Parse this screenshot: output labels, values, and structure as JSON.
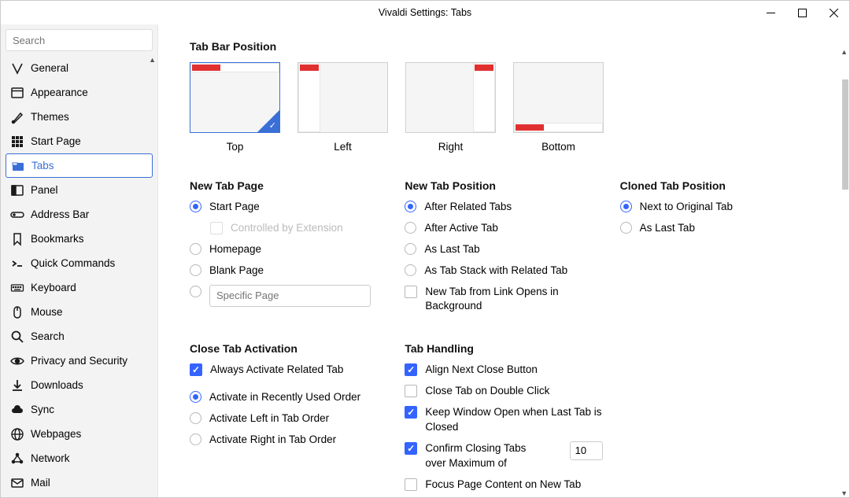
{
  "window": {
    "title": "Vivaldi Settings: Tabs"
  },
  "search": {
    "placeholder": "Search"
  },
  "sidebar": {
    "items": [
      {
        "name": "general",
        "label": "General"
      },
      {
        "name": "appearance",
        "label": "Appearance"
      },
      {
        "name": "themes",
        "label": "Themes"
      },
      {
        "name": "start-page",
        "label": "Start Page"
      },
      {
        "name": "tabs",
        "label": "Tabs",
        "selected": true
      },
      {
        "name": "panel",
        "label": "Panel"
      },
      {
        "name": "address-bar",
        "label": "Address Bar"
      },
      {
        "name": "bookmarks",
        "label": "Bookmarks"
      },
      {
        "name": "quick-commands",
        "label": "Quick Commands"
      },
      {
        "name": "keyboard",
        "label": "Keyboard"
      },
      {
        "name": "mouse",
        "label": "Mouse"
      },
      {
        "name": "search",
        "label": "Search"
      },
      {
        "name": "privacy",
        "label": "Privacy and Security"
      },
      {
        "name": "downloads",
        "label": "Downloads"
      },
      {
        "name": "sync",
        "label": "Sync"
      },
      {
        "name": "webpages",
        "label": "Webpages"
      },
      {
        "name": "network",
        "label": "Network"
      },
      {
        "name": "mail",
        "label": "Mail"
      }
    ]
  },
  "section": {
    "tab_bar_position": {
      "title": "Tab Bar Position",
      "options": {
        "top": "Top",
        "left": "Left",
        "right": "Right",
        "bottom": "Bottom"
      }
    },
    "new_tab_page": {
      "title": "New Tab Page",
      "start_page": "Start Page",
      "controlled_by_ext": "Controlled by Extension",
      "homepage": "Homepage",
      "blank_page": "Blank Page",
      "specific_placeholder": "Specific Page"
    },
    "new_tab_position": {
      "title": "New Tab Position",
      "after_related": "After Related Tabs",
      "after_active": "After Active Tab",
      "as_last": "As Last Tab",
      "as_stack": "As Tab Stack with Related Tab",
      "link_bg": "New Tab from Link Opens in Background"
    },
    "cloned_tab_position": {
      "title": "Cloned Tab Position",
      "next_original": "Next to Original Tab",
      "as_last": "As Last Tab"
    },
    "close_tab_activation": {
      "title": "Close Tab Activation",
      "always_related": "Always Activate Related Tab",
      "recent_order": "Activate in Recently Used Order",
      "left_order": "Activate Left in Tab Order",
      "right_order": "Activate Right in Tab Order"
    },
    "tab_handling": {
      "title": "Tab Handling",
      "align_close": "Align Next Close Button",
      "dbl_click": "Close Tab on Double Click",
      "keep_open": "Keep Window Open when Last Tab is Closed",
      "confirm_close": "Confirm Closing Tabs over Maximum of",
      "confirm_value": "10",
      "focus_content": "Focus Page Content on New Tab"
    }
  }
}
